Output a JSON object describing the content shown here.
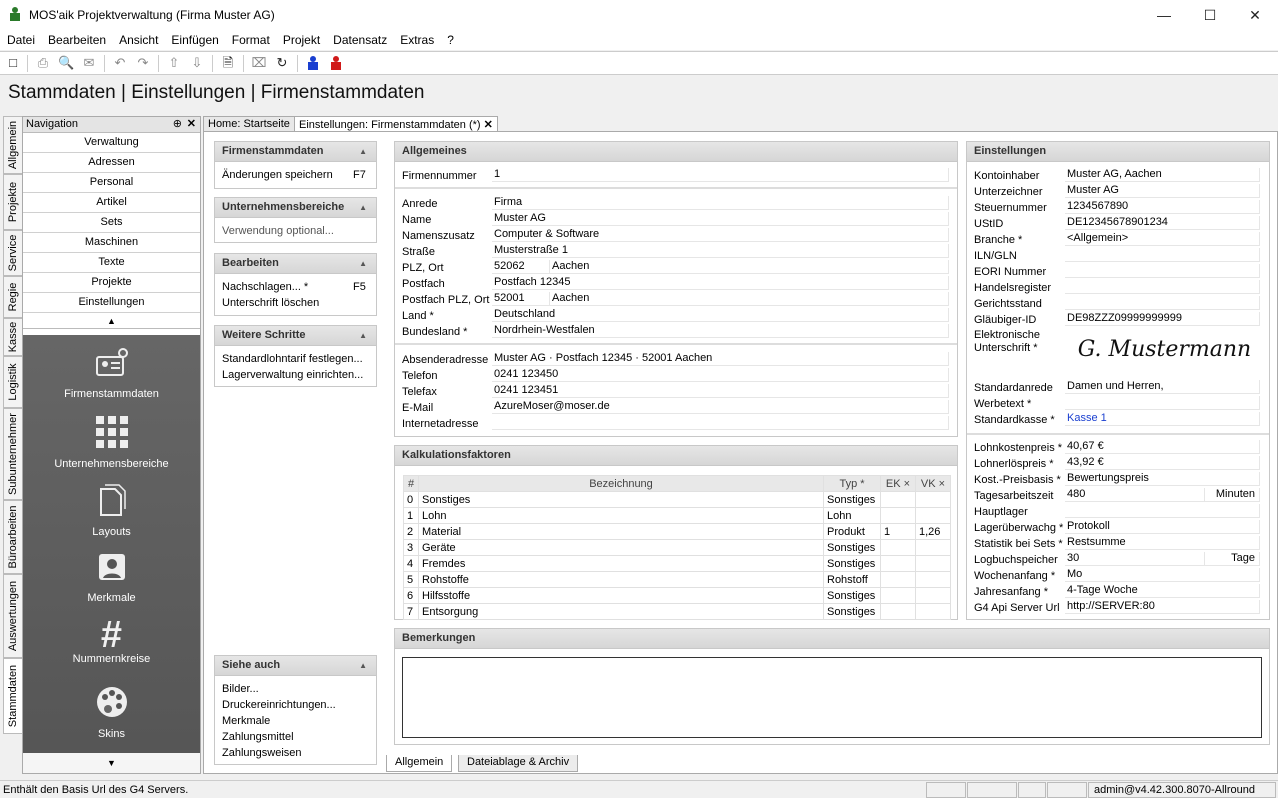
{
  "window": {
    "title": "MOS'aik Projektverwaltung (Firma Muster AG)"
  },
  "menu": [
    "Datei",
    "Bearbeiten",
    "Ansicht",
    "Einfügen",
    "Format",
    "Projekt",
    "Datensatz",
    "Extras",
    "?"
  ],
  "page_title": "Stammdaten | Einstellungen | Firmenstammdaten",
  "vtabs": [
    "Allgemein",
    "Projekte",
    "Service",
    "Regie",
    "Kasse",
    "Logistik",
    "Subunternehmer",
    "Büroarbeiten",
    "Auswertungen",
    "Stammdaten"
  ],
  "nav": {
    "title": "Navigation",
    "items": [
      "Verwaltung",
      "Adressen",
      "Personal",
      "Artikel",
      "Sets",
      "Maschinen",
      "Texte",
      "Projekte",
      "Einstellungen"
    ],
    "big": [
      "Firmenstammdaten",
      "Unternehmensbereiche",
      "Layouts",
      "Merkmale",
      "Nummernkreise",
      "Skins"
    ]
  },
  "doctabs": [
    "Home: Startseite",
    "Einstellungen: Firmenstammdaten (*)"
  ],
  "tasks": {
    "firmenstammdaten": {
      "title": "Firmenstammdaten",
      "item": "Änderungen speichern",
      "key": "F7"
    },
    "unternehmensbereiche": {
      "title": "Unternehmensbereiche",
      "item": "Verwendung optional..."
    },
    "bearbeiten": {
      "title": "Bearbeiten",
      "items": [
        "Nachschlagen... *",
        "Unterschrift löschen"
      ],
      "key": "F5"
    },
    "weitere": {
      "title": "Weitere Schritte",
      "items": [
        "Standardlohntarif festlegen...",
        "Lagerverwaltung einrichten..."
      ]
    },
    "siehe": {
      "title": "Siehe auch",
      "items": [
        "Bilder...",
        "Druckereinrichtungen...",
        "Merkmale",
        "Zahlungsmittel",
        "Zahlungsweisen"
      ]
    }
  },
  "allgemeines": {
    "title": "Allgemeines",
    "firmennummer": {
      "label": "Firmennummer",
      "value": "1"
    },
    "anrede": {
      "label": "Anrede",
      "value": "Firma"
    },
    "name": {
      "label": "Name",
      "value": "Muster AG"
    },
    "namenszusatz": {
      "label": "Namenszusatz",
      "value": "Computer & Software"
    },
    "strasse": {
      "label": "Straße",
      "value": "Musterstraße 1"
    },
    "plz_ort": {
      "label": "PLZ, Ort",
      "plz": "52062",
      "ort": "Aachen"
    },
    "postfach": {
      "label": "Postfach",
      "value": "Postfach 12345"
    },
    "postfach_plz": {
      "label": "Postfach PLZ, Ort",
      "plz": "52001",
      "ort": "Aachen"
    },
    "land": {
      "label": "Land *",
      "value": "Deutschland"
    },
    "bundesland": {
      "label": "Bundesland *",
      "value": "Nordrhein-Westfalen"
    },
    "absender": {
      "label": "Absenderadresse",
      "value": "Muster AG · Postfach 12345 · 52001 Aachen"
    },
    "telefon": {
      "label": "Telefon",
      "value": "0241 123450"
    },
    "telefax": {
      "label": "Telefax",
      "value": "0241 123451"
    },
    "email": {
      "label": "E-Mail",
      "value": "AzureMoser@moser.de"
    },
    "internet": {
      "label": "Internetadresse",
      "value": ""
    }
  },
  "kalkulation": {
    "title": "Kalkulationsfaktoren",
    "headers": [
      "#",
      "Bezeichnung",
      "Typ *",
      "EK ×",
      "VK ×"
    ],
    "rows": [
      [
        "0",
        "Sonstiges",
        "Sonstiges",
        "",
        ""
      ],
      [
        "1",
        "Lohn",
        "Lohn",
        "",
        ""
      ],
      [
        "2",
        "Material",
        "Produkt",
        "1",
        "1,26"
      ],
      [
        "3",
        "Geräte",
        "Sonstiges",
        "",
        ""
      ],
      [
        "4",
        "Fremdes",
        "Sonstiges",
        "",
        ""
      ],
      [
        "5",
        "Rohstoffe",
        "Rohstoff",
        "",
        ""
      ],
      [
        "6",
        "Hilfsstoffe",
        "Sonstiges",
        "",
        ""
      ],
      [
        "7",
        "Entsorgung",
        "Sonstiges",
        "",
        ""
      ]
    ]
  },
  "bemerkungen": {
    "title": "Bemerkungen",
    "value": ""
  },
  "einstellungen": {
    "title": "Einstellungen",
    "a": [
      [
        "Kontoinhaber",
        "Muster AG, Aachen"
      ],
      [
        "Unterzeichner",
        "Muster AG"
      ],
      [
        "Steuernummer",
        "1234567890"
      ],
      [
        "UStID",
        "DE12345678901234"
      ],
      [
        "Branche *",
        "<Allgemein>"
      ],
      [
        "ILN/GLN",
        ""
      ],
      [
        "EORI Nummer",
        ""
      ],
      [
        "Handelsregister",
        ""
      ],
      [
        "Gerichtsstand",
        ""
      ],
      [
        "Gläubiger-ID",
        "DE98ZZZ09999999999"
      ]
    ],
    "signature_label": "Elektronische Unterschrift *",
    "signature": "G. Mustermann",
    "b": [
      [
        "Standardanrede",
        "Damen und Herren,"
      ],
      [
        "Werbetext *",
        ""
      ],
      [
        "Standardkasse *",
        "Kasse 1"
      ]
    ],
    "c": [
      [
        "Lohnkostenpreis *",
        "40,67 €"
      ],
      [
        "Lohnerlöspreis *",
        "43,92 €"
      ],
      [
        "Kost.-Preisbasis *",
        "Bewertungspreis"
      ],
      [
        "Tagesarbeitszeit",
        "480"
      ],
      [
        "Hauptlager",
        ""
      ],
      [
        "Lagerüberwachg *",
        "Protokoll"
      ],
      [
        "Statistik bei Sets *",
        "Restsumme"
      ],
      [
        "Logbuchspeicher",
        "30"
      ],
      [
        "Wochenanfang *",
        "Mo"
      ],
      [
        "Jahresanfang *",
        "4-Tage Woche"
      ],
      [
        "G4 Api Server Url",
        "http://SERVER:80"
      ]
    ],
    "minuten": "Minuten",
    "tage": "Tage"
  },
  "bottomtabs": [
    "Allgemein",
    "Dateiablage & Archiv"
  ],
  "status": {
    "text": "Enthält den Basis Url des G4 Servers.",
    "user": "admin@v4.42.300.8070-Allround"
  }
}
